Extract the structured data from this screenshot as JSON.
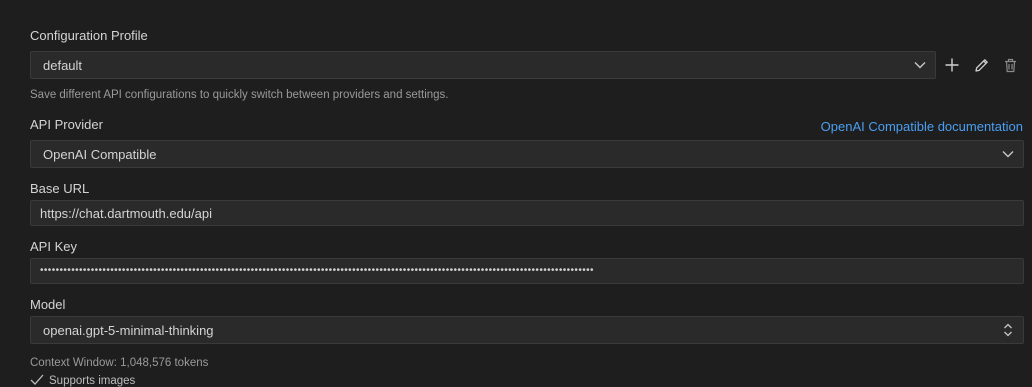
{
  "config_profile": {
    "label": "Configuration Profile",
    "selected": "default",
    "help_text": "Save different API configurations to quickly switch between providers and settings.",
    "actions": [
      "add-icon",
      "edit-icon",
      "delete-icon"
    ]
  },
  "api_provider": {
    "label": "API Provider",
    "doc_link": "OpenAI Compatible documentation",
    "selected": "OpenAI Compatible"
  },
  "base_url": {
    "label": "Base URL",
    "value": "https://chat.dartmouth.edu/api"
  },
  "api_key": {
    "label": "API Key",
    "value": "••••••••••••••••••••••••••••••••••••••••••••••••••••••••••••••••••••••••••••••••••••••••••••••••••••••••••••••••••••••••••••••••••••••••••••••"
  },
  "model": {
    "label": "Model",
    "selected": "openai.gpt-5-minimal-thinking",
    "context_window": "Context Window: 1,048,576 tokens",
    "supports_images": "Supports images"
  },
  "colors": {
    "background": "#1e1e1e",
    "field_bg": "#2a2a2a",
    "link": "#4b9ff0"
  }
}
